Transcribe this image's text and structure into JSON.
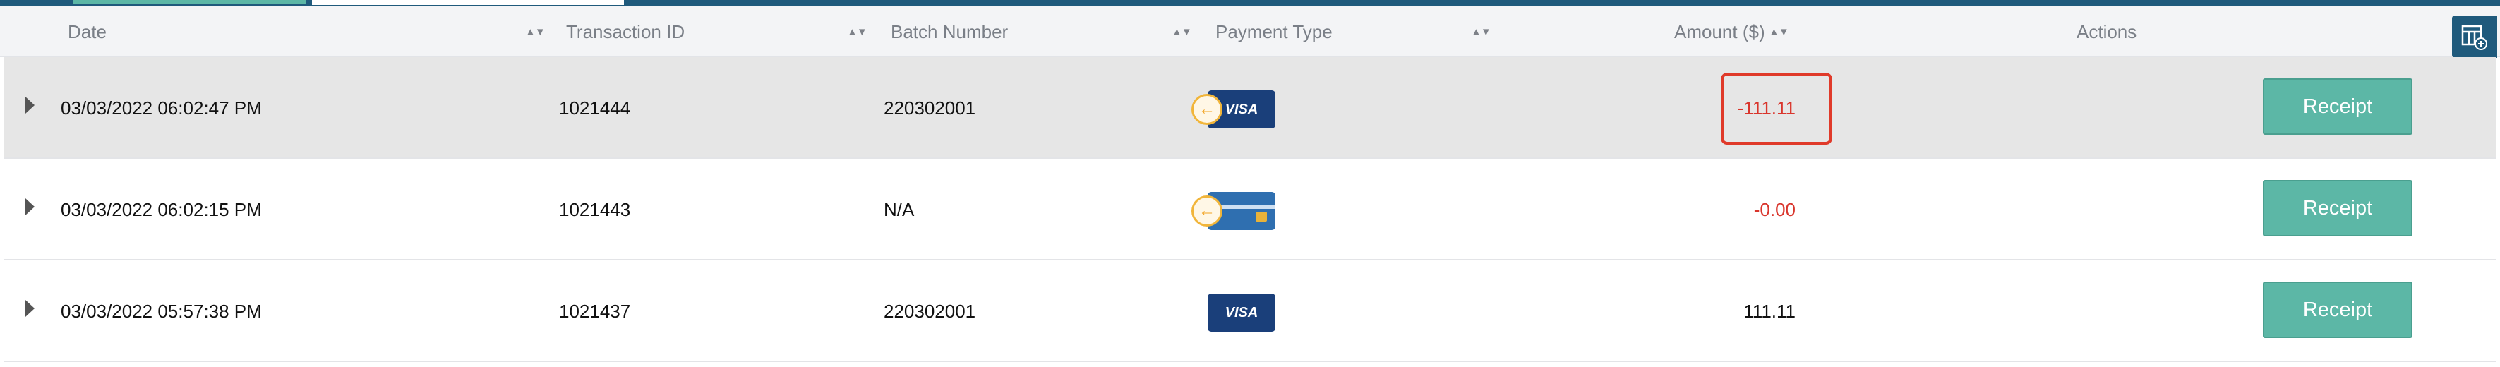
{
  "header": {
    "columns": [
      {
        "label": "Date",
        "sortable": true
      },
      {
        "label": "Transaction ID",
        "sortable": true
      },
      {
        "label": "Batch Number",
        "sortable": true
      },
      {
        "label": "Payment Type",
        "sortable": true
      },
      {
        "label": "Amount ($)",
        "sortable": true
      },
      {
        "label": "Actions",
        "sortable": false
      }
    ],
    "sort_glyph": "▲▼",
    "settings_icon": "table-columns-settings-icon"
  },
  "rows": [
    {
      "date": "03/03/2022 06:02:47 PM",
      "transaction_id": "1021444",
      "batch_number": "220302001",
      "payment_type": {
        "card": "visa",
        "brand_text": "VISA",
        "refund_icon": true
      },
      "amount": "-111.11",
      "amount_negative": true,
      "highlighted": true,
      "selected": true,
      "action_label": "Receipt"
    },
    {
      "date": "03/03/2022 06:02:15 PM",
      "transaction_id": "1021443",
      "batch_number": "N/A",
      "payment_type": {
        "card": "generic",
        "brand_text": "",
        "refund_icon": true
      },
      "amount": "-0.00",
      "amount_negative": true,
      "highlighted": false,
      "selected": false,
      "action_label": "Receipt"
    },
    {
      "date": "03/03/2022 05:57:38 PM",
      "transaction_id": "1021437",
      "batch_number": "220302001",
      "payment_type": {
        "card": "visa",
        "brand_text": "VISA",
        "refund_icon": false
      },
      "amount": "111.11",
      "amount_negative": false,
      "highlighted": false,
      "selected": false,
      "action_label": "Receipt"
    }
  ],
  "colors": {
    "accent": "#1f5a7c",
    "button": "#5cb7a6",
    "negative": "#d9352c",
    "highlight_box": "#e03a2a"
  },
  "icons": {
    "expand": "caret-right-icon",
    "refund": "refund-arrow-icon",
    "visa": "visa-card-icon",
    "generic_card": "credit-card-icon"
  }
}
